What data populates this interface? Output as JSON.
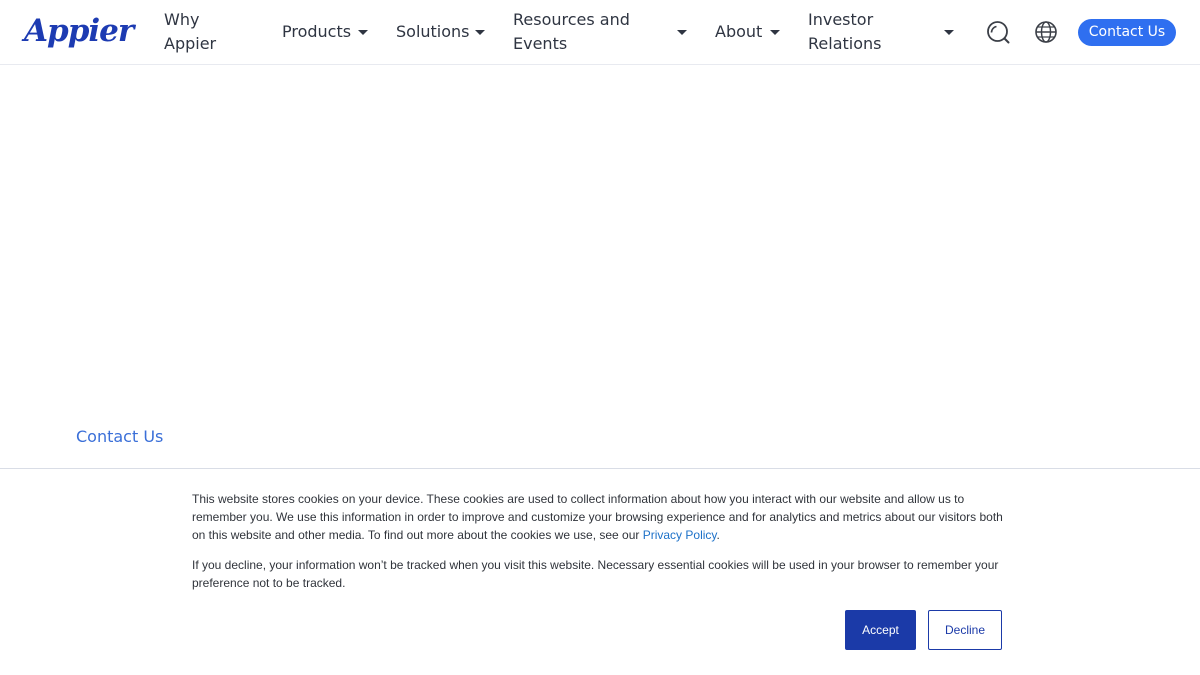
{
  "header": {
    "logo_text": "Appier",
    "nav": [
      {
        "line1": "Why",
        "line2": "Appier"
      },
      {
        "line1": "Products",
        "line2": ""
      },
      {
        "line1": "Solutions",
        "line2": ""
      },
      {
        "line1": "Resources and",
        "line2": "Events"
      },
      {
        "line1": "About",
        "line2": ""
      },
      {
        "line1": "Investor",
        "line2": "Relations"
      }
    ],
    "search_icon": "search-icon",
    "language_icon": "globe-icon",
    "contact_label": "Contact Us",
    "accent_color": "#2f6ff0"
  },
  "main": {
    "contact_link": "Contact Us"
  },
  "cookie_banner": {
    "paragraph1": "This website stores cookies on your device. These cookies are used to collect information about how you interact with our website and allow us to remember you. We use this information in order to improve and customize your browsing experience and for analytics and metrics about our visitors both on this website and other media. To find out more about the cookies we use, see our ",
    "privacy_link": "Privacy Policy",
    "paragraph1_end": ".",
    "paragraph2": "If you decline, your information won’t be tracked when you visit this website. Necessary essential cookies will be used in your browser to remember your preference not to be tracked.",
    "accept_label": "Accept",
    "decline_label": "Decline",
    "button_color": "#1b3aa8"
  }
}
